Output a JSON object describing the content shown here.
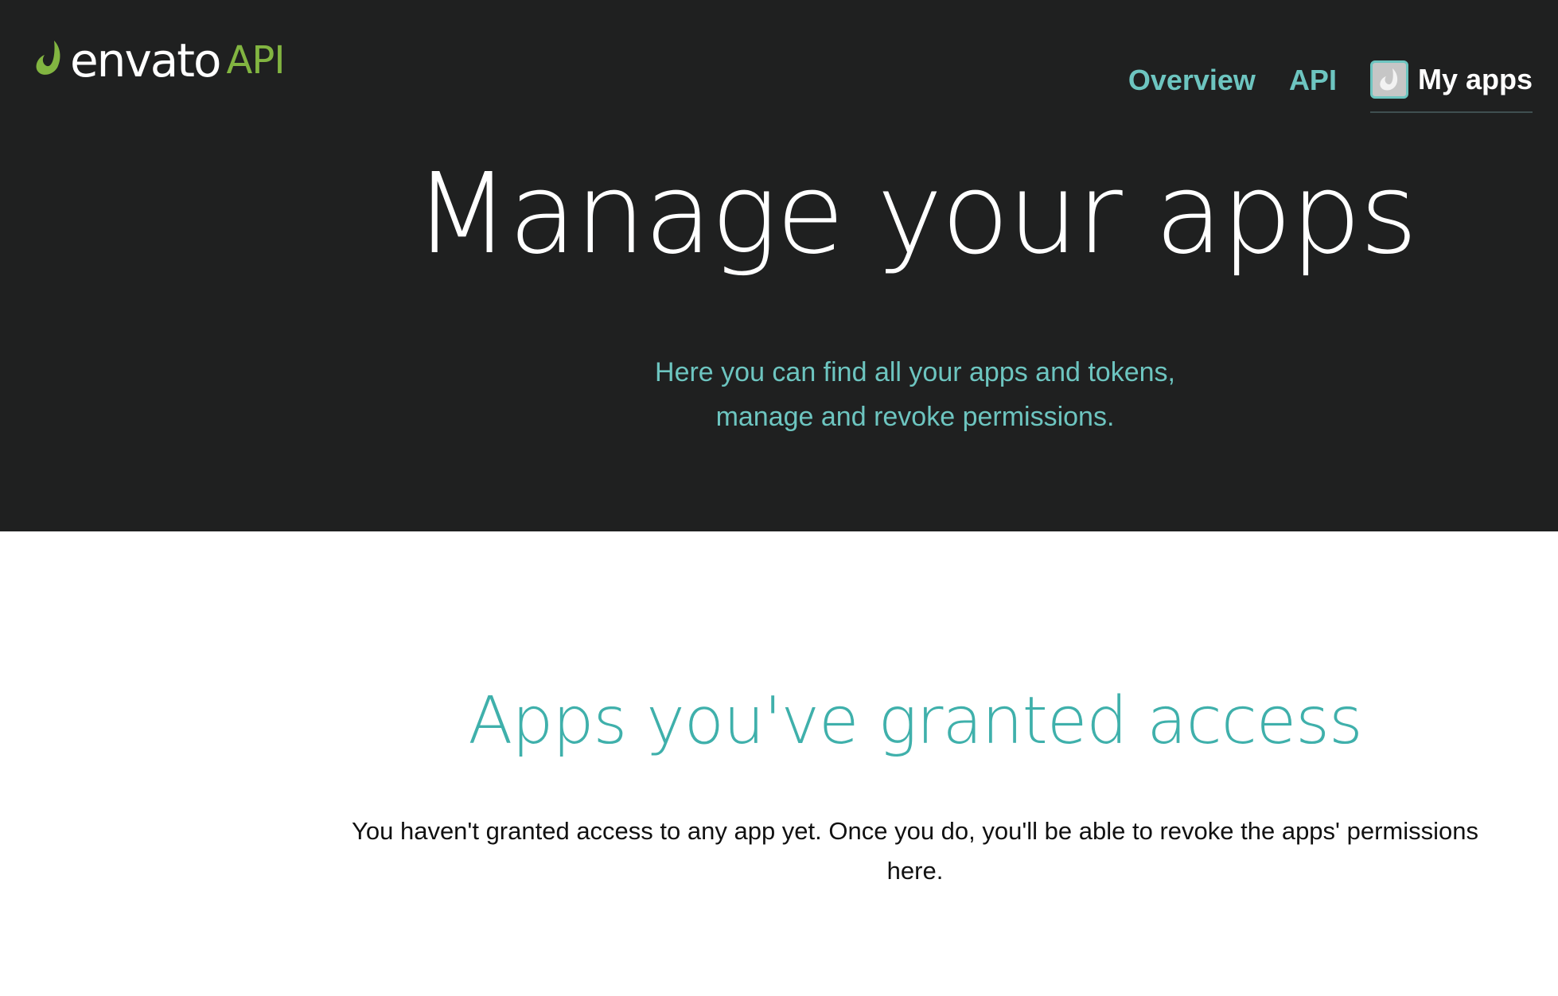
{
  "header": {
    "logo": {
      "icon": "envato-leaf-icon",
      "wordmark": "envato",
      "suffix": "API",
      "wordmark_color": "#ffffff",
      "suffix_color": "#82b541"
    },
    "nav": [
      {
        "label": "Overview"
      },
      {
        "label": "API"
      },
      {
        "label": "My apps",
        "avatar_icon": "user-avatar-icon"
      }
    ]
  },
  "hero": {
    "title": "Manage your apps",
    "subtitle_line1": "Here you can find all your apps and tokens,",
    "subtitle_line2": "manage and revoke permissions.",
    "background_color": "#1f2020",
    "accent_color": "#6dc5c0"
  },
  "granted_section": {
    "title": "Apps you've granted access",
    "message_line1": "You haven't granted access to any app yet. Once you do, you'll be able to revoke the apps' permissions",
    "message_line2": "here.",
    "title_color": "#3fb0ab"
  }
}
